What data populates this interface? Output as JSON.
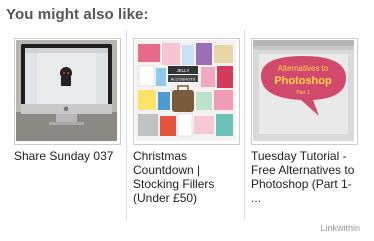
{
  "widget": {
    "title": "You might also like:",
    "credit": "Linkwithin"
  },
  "items": [
    {
      "caption": "Share Sunday 037",
      "thumb_icon": "imac-screenshot-image"
    },
    {
      "caption": "Christmas Countdown | Stocking Fillers (Under £50)",
      "thumb_icon": "product-collage-image",
      "thumb_text": [
        "JELLY",
        "ALCOSHOTS"
      ]
    },
    {
      "caption": "Tuesday Tutorial - Free Alternatives to Photoshop (Part 1- ...",
      "thumb_icon": "speech-bubble-graphic-image",
      "thumb_text": [
        "Alternatives to",
        "Photoshop",
        "Part 1"
      ]
    }
  ]
}
